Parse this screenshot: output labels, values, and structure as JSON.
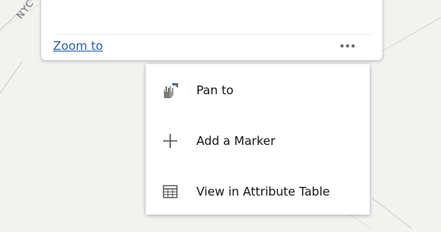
{
  "map": {
    "road_label": "NYC"
  },
  "popup": {
    "zoom_to_label": "Zoom to",
    "more_icon": "more-horizontal-icon"
  },
  "menu": {
    "items": [
      {
        "label": "Pan to",
        "icon": "pan-hand-icon"
      },
      {
        "label": "Add a Marker",
        "icon": "plus-icon"
      },
      {
        "label": "View in Attribute Table",
        "icon": "table-icon"
      }
    ]
  },
  "colors": {
    "link": "#2a5db0",
    "map_background": "#f2f2f0",
    "text": "#151515"
  }
}
